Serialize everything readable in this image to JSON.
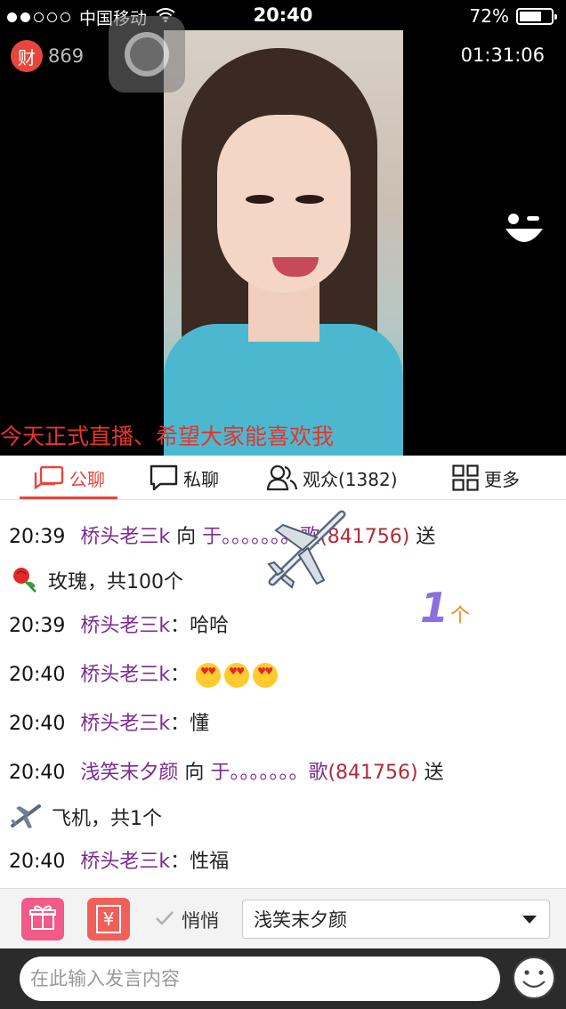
{
  "status_bar": {
    "carrier": "中国移动",
    "time": "20:40",
    "battery": "72%",
    "battery_level": 0.72
  },
  "room": {
    "wealth_icon_text": "财",
    "wealth_count": "869",
    "duration": "01:31:06",
    "caption": "今天正式直播、希望大家能喜欢我"
  },
  "tabs": [
    {
      "label": "公聊"
    },
    {
      "label": "私聊"
    },
    {
      "label": "观众(1382)"
    },
    {
      "label": "更多"
    }
  ],
  "chat": {
    "messages": [
      {
        "time": "20:39",
        "user": "桥头老三k",
        "verb": "向",
        "to": "于。。。。。。。歌",
        "room": "(841756)",
        "action": "送",
        "gift": "玫瑰，共100个"
      },
      {
        "time": "20:39",
        "user": "桥头老三k",
        "sep": "：",
        "text": "哈哈"
      },
      {
        "time": "20:40",
        "user": "桥头老三k",
        "sep": "："
      },
      {
        "time": "20:40",
        "user": "桥头老三k",
        "sep": "：",
        "text": "懂"
      },
      {
        "time": "20:40",
        "user": "浅笑末夕颜",
        "verb": "向",
        "to": "于。。。。。。。歌",
        "room": "(841756)",
        "action": "送",
        "gift": "飞机，共1个"
      },
      {
        "time": "20:40",
        "user": "桥头老三k",
        "sep": "：",
        "text": "性福"
      }
    ],
    "gift_count": "1",
    "gift_count_unit": "个"
  },
  "toolbar": {
    "money_icon_text": "¥",
    "quiet_label": "悄悄",
    "recipient_selected": "浅笑末夕颜"
  },
  "input": {
    "placeholder": "在此输入发言内容"
  },
  "colors": {
    "accent": "#e8453c",
    "username": "#7b2b8f",
    "room_id": "#b12a3a",
    "gift_button": "#f25a88",
    "money_button": "#f0605a"
  }
}
